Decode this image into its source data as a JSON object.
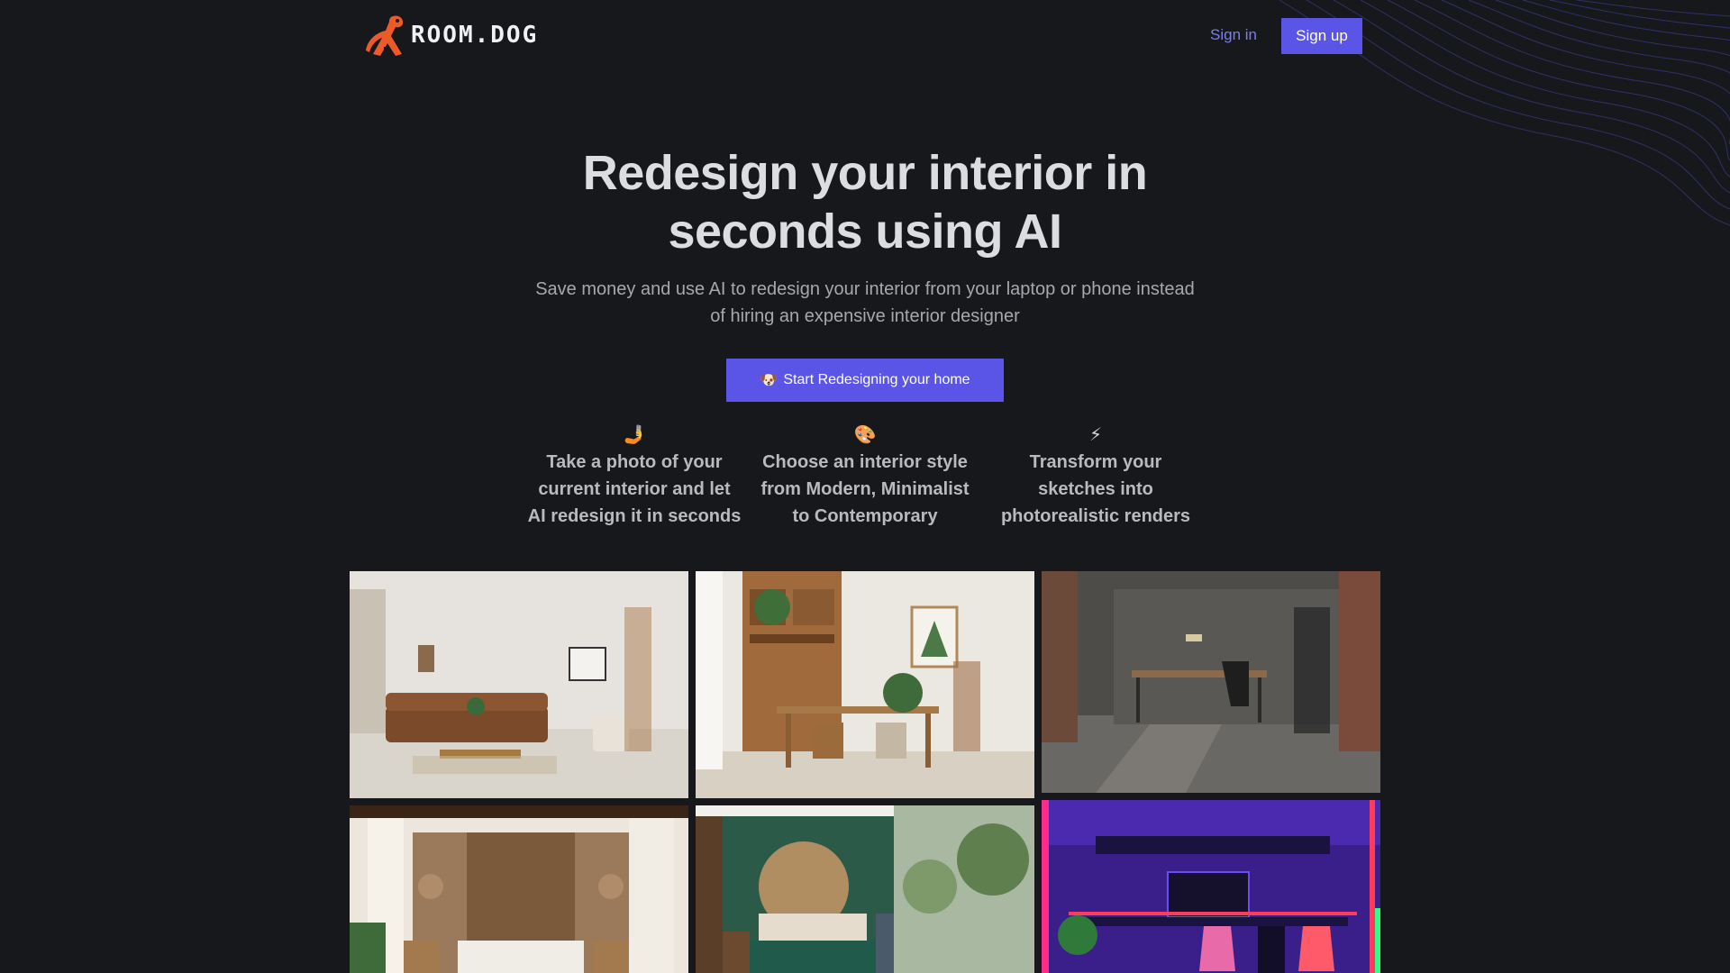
{
  "brand": {
    "name": "ROOM.DOG",
    "accent": "#5a55e6",
    "logo_color": "#ec5a2a"
  },
  "nav": {
    "signin_label": "Sign in",
    "signup_label": "Sign up"
  },
  "hero": {
    "title_line1": "Redesign your interior in",
    "title_line2": "seconds using AI",
    "subtitle_line1": "Save money and use AI to redesign your interior from your laptop or phone instead",
    "subtitle_line2": "of hiring an expensive interior designer",
    "cta_icon": "🐶",
    "cta_label": "Start Redesigning your home"
  },
  "features": [
    {
      "icon": "🤳",
      "line1": "Take a photo of your",
      "line2": "current interior and let",
      "line3": "AI redesign it in seconds"
    },
    {
      "icon": "🎨",
      "line1": "Choose an interior style",
      "line2": "from Modern, Minimalist",
      "line3": "to Contemporary"
    },
    {
      "icon": "⚡",
      "line1": "Transform your",
      "line2": "sketches into",
      "line3": "photorealistic renders"
    }
  ],
  "gallery": [
    {
      "icon": "living-room-image"
    },
    {
      "icon": "dining-room-image"
    },
    {
      "icon": "industrial-office-image"
    },
    {
      "icon": "bedroom-image"
    },
    {
      "icon": "green-bedroom-image"
    },
    {
      "icon": "neon-gaming-room-image"
    }
  ]
}
